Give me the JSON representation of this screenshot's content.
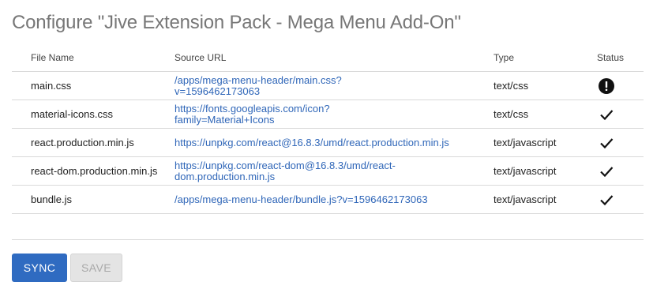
{
  "title": "Configure \"Jive Extension Pack - Mega Menu Add-On\"",
  "table": {
    "headers": {
      "file_name": "File Name",
      "source_url": "Source URL",
      "type": "Type",
      "status": "Status"
    },
    "rows": [
      {
        "file_name": "main.css",
        "source_url": "/apps/mega-menu-header/main.css?v=1596462173063",
        "type": "text/css",
        "status": "error",
        "status_icon": "error-circle-icon"
      },
      {
        "file_name": "material-icons.css",
        "source_url": "https://fonts.googleapis.com/icon?family=Material+Icons",
        "type": "text/css",
        "status": "ok",
        "status_icon": "checkmark-icon"
      },
      {
        "file_name": "react.production.min.js",
        "source_url": "https://unpkg.com/react@16.8.3/umd/react.production.min.js",
        "type": "text/javascript",
        "status": "ok",
        "status_icon": "checkmark-icon"
      },
      {
        "file_name": "react-dom.production.min.js",
        "source_url": "https://unpkg.com/react-dom@16.8.3/umd/react-dom.production.min.js",
        "type": "text/javascript",
        "status": "ok",
        "status_icon": "checkmark-icon"
      },
      {
        "file_name": "bundle.js",
        "source_url": "/apps/mega-menu-header/bundle.js?v=1596462173063",
        "type": "text/javascript",
        "status": "ok",
        "status_icon": "checkmark-icon"
      }
    ]
  },
  "buttons": {
    "sync_label": "SYNC",
    "save_label": "SAVE",
    "save_disabled": true
  },
  "colors": {
    "link": "#2f66b8",
    "primary_button": "#2f6bc1",
    "title": "#777777"
  }
}
